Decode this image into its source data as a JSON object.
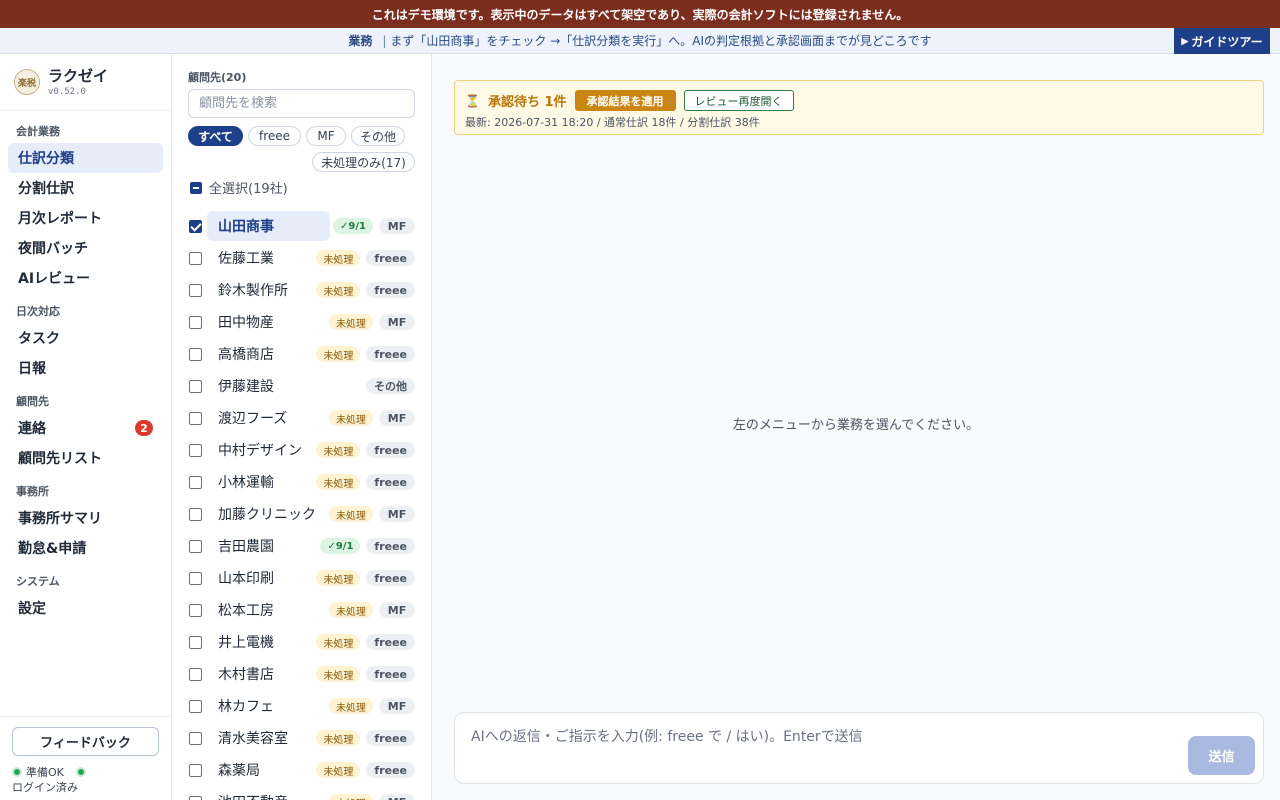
{
  "banner": {
    "text": "これはデモ環境です。表示中のデータはすべて架空であり、実際の会計ソフトには登録されません。"
  },
  "guide": {
    "label": "業務",
    "separator": "|",
    "text": "まず「山田商事」をチェック →「仕訳分類を実行」へ。AIの判定根拠と承認画面までが見どころです",
    "tour_button": "ガイドツアー"
  },
  "brand": {
    "logo_text": "楽税",
    "name": "ラクゼイ",
    "version": "v0.52.0"
  },
  "nav": {
    "sections": [
      {
        "title": "会計業務",
        "items": [
          {
            "label": "仕訳分類",
            "active": true
          },
          {
            "label": "分割仕訳"
          },
          {
            "label": "月次レポート"
          },
          {
            "label": "夜間バッチ"
          },
          {
            "label": "AIレビュー"
          }
        ]
      },
      {
        "title": "日次対応",
        "items": [
          {
            "label": "タスク"
          },
          {
            "label": "日報"
          }
        ]
      },
      {
        "title": "顧問先",
        "items": [
          {
            "label": "連絡",
            "badge": "2"
          },
          {
            "label": "顧問先リスト"
          }
        ]
      },
      {
        "title": "事務所",
        "items": [
          {
            "label": "事務所サマリ"
          },
          {
            "label": "勤怠&申請"
          }
        ]
      },
      {
        "title": "システム",
        "items": [
          {
            "label": "設定"
          }
        ]
      }
    ]
  },
  "footer": {
    "feedback": "フィードバック",
    "status": "準備OK",
    "login": "ログイン済み"
  },
  "clients": {
    "title": "顧問先(20)",
    "search_placeholder": "顧問先を検索",
    "filters": {
      "all": "すべて",
      "freee": "freee",
      "mf": "MF",
      "other": "その他",
      "unprocessed": "未処理のみ(17)"
    },
    "select_all": "全選択(19社)",
    "items": [
      {
        "name": "山田商事",
        "status": "✓9/1",
        "status_kind": "done",
        "software": "MF",
        "checked": true,
        "selected": true
      },
      {
        "name": "佐藤工業",
        "status": "未処理",
        "status_kind": "pending",
        "software": "freee"
      },
      {
        "name": "鈴木製作所",
        "status": "未処理",
        "status_kind": "pending",
        "software": "freee"
      },
      {
        "name": "田中物産",
        "status": "未処理",
        "status_kind": "pending",
        "software": "MF"
      },
      {
        "name": "高橋商店",
        "status": "未処理",
        "status_kind": "pending",
        "software": "freee"
      },
      {
        "name": "伊藤建設",
        "status": "",
        "status_kind": "none",
        "software": "その他"
      },
      {
        "name": "渡辺フーズ",
        "status": "未処理",
        "status_kind": "pending",
        "software": "MF"
      },
      {
        "name": "中村デザイン",
        "status": "未処理",
        "status_kind": "pending",
        "software": "freee"
      },
      {
        "name": "小林運輸",
        "status": "未処理",
        "status_kind": "pending",
        "software": "freee"
      },
      {
        "name": "加藤クリニック",
        "status": "未処理",
        "status_kind": "pending",
        "software": "MF"
      },
      {
        "name": "吉田農園",
        "status": "✓9/1",
        "status_kind": "done",
        "software": "freee"
      },
      {
        "name": "山本印刷",
        "status": "未処理",
        "status_kind": "pending",
        "software": "freee"
      },
      {
        "name": "松本工房",
        "status": "未処理",
        "status_kind": "pending",
        "software": "MF"
      },
      {
        "name": "井上電機",
        "status": "未処理",
        "status_kind": "pending",
        "software": "freee"
      },
      {
        "name": "木村書店",
        "status": "未処理",
        "status_kind": "pending",
        "software": "freee"
      },
      {
        "name": "林カフェ",
        "status": "未処理",
        "status_kind": "pending",
        "software": "MF"
      },
      {
        "name": "清水美容室",
        "status": "未処理",
        "status_kind": "pending",
        "software": "freee"
      },
      {
        "name": "森薬局",
        "status": "未処理",
        "status_kind": "pending",
        "software": "freee"
      },
      {
        "name": "池田不動産",
        "status": "未処理",
        "status_kind": "pending",
        "software": "MF"
      }
    ]
  },
  "approval": {
    "title": "承認待ち 1件",
    "apply": "承認結果を適用",
    "reopen": "レビュー再度開く",
    "meta": "最新: 2026-07-31 18:20 / 通常仕訳 18件 / 分割仕訳 38件"
  },
  "main": {
    "empty": "左のメニューから業務を選んでください。"
  },
  "composer": {
    "placeholder": "AIへの返信・ご指示を入力(例: freee で / はい)。Enterで送信",
    "value": "",
    "send": "送信"
  },
  "colors": {
    "banner": "#7b2d1e",
    "accent": "#1e3f8a",
    "pending": "#fdf3d3",
    "done": "#ddf3e4",
    "approval": "#fff9e6"
  }
}
